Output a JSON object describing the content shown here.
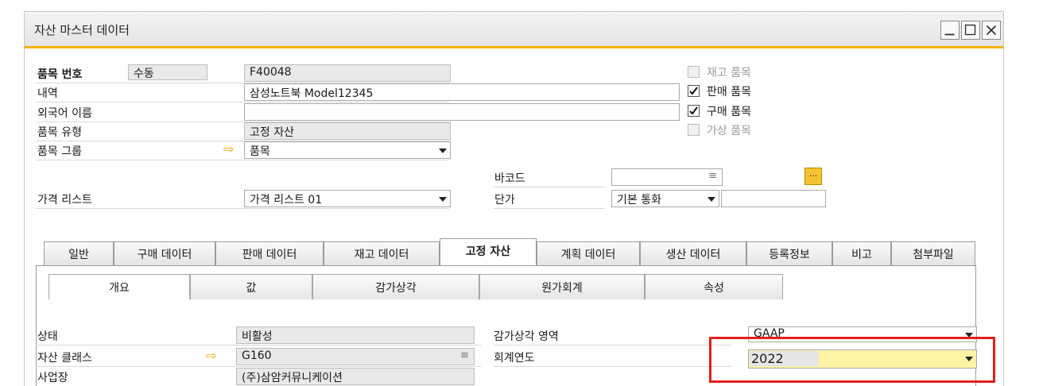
{
  "window": {
    "title": "자산 마스터 데이터",
    "buttons": {
      "minimize": "_",
      "maximize": "□",
      "close": "×"
    }
  },
  "header": {
    "item_no_label": "품목 번호",
    "item_no_mode": "수동",
    "item_no_value": "F40048",
    "description_label": "내역",
    "description_value": "삼성노트북 Model12345",
    "foreign_name_label": "외국어 이름",
    "foreign_name_value": "",
    "item_type_label": "품목 유형",
    "item_type_value": "고정 자산",
    "item_group_label": "품목 그룹",
    "item_group_value": "품목",
    "barcode_label": "바코드",
    "barcode_value": "",
    "price_list_label": "가격 리스트",
    "price_list_value": "가격 리스트 01",
    "unit_price_label": "단가",
    "currency_value": "기본 통화",
    "unit_price_value": "",
    "browse_label": "..."
  },
  "checkboxes": [
    {
      "label": "재고 품목",
      "checked": false,
      "disabled": true
    },
    {
      "label": "판매 품목",
      "checked": true,
      "disabled": false
    },
    {
      "label": "구매 품목",
      "checked": true,
      "disabled": false
    },
    {
      "label": "가상 품목",
      "checked": false,
      "disabled": true
    }
  ],
  "tabs": [
    "일반",
    "구매 데이터",
    "판매 데이터",
    "재고 데이터",
    "고정 자산",
    "계획 데이터",
    "생산 데이터",
    "등록정보",
    "비고",
    "첨부파일"
  ],
  "active_tab": "고정 자산",
  "subtabs": [
    "개요",
    "값",
    "감가상각",
    "원가회계",
    "속성"
  ],
  "active_subtab": "개요",
  "general": {
    "status_label": "상태",
    "status_value": "비활성",
    "asset_class_label": "자산 클래스",
    "asset_class_value": "G160",
    "location_label": "사업장",
    "location_value": "(주)삼암커뮤니케이션",
    "depreciation_area_label": "감가상각 영역",
    "depreciation_area_value": "GAAP",
    "fiscal_year_label": "회계연도",
    "fiscal_year_value": "2022"
  },
  "colors": {
    "accent": "#f0b400",
    "highlight": "#e61e1e",
    "field_yellow": "#fff3a6"
  }
}
